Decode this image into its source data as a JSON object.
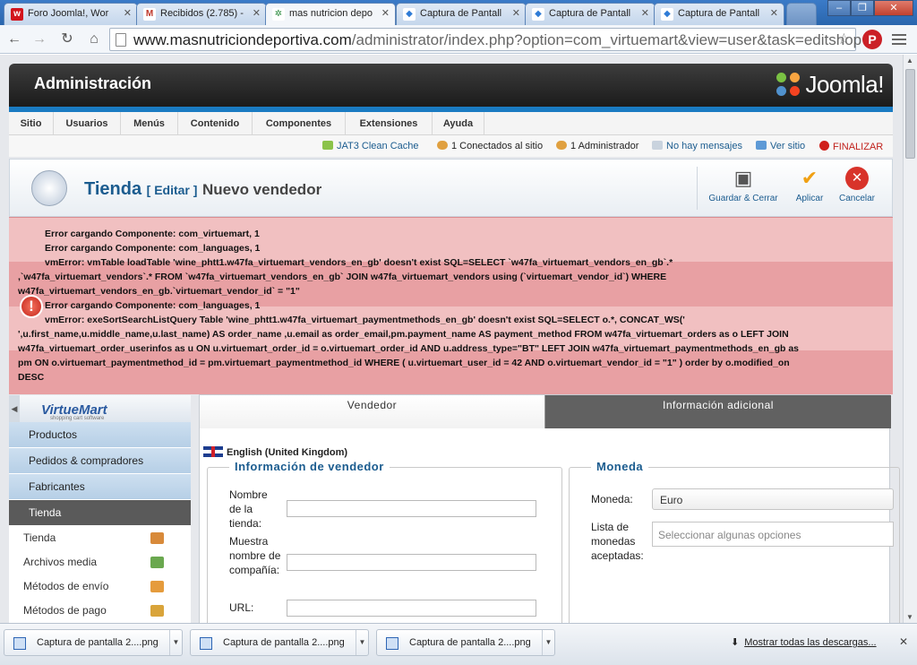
{
  "browser": {
    "tabs": [
      {
        "title": "Foro Joomla!, Wor",
        "icon": "w-favicon-icon",
        "color": "#d2151d",
        "glyph": "w"
      },
      {
        "title": "Recibidos (2.785) -",
        "icon": "gmail-icon",
        "color": "#c0392b",
        "glyph": "M"
      },
      {
        "title": "mas nutricion depo",
        "icon": "joomla-favicon-icon",
        "color": "#2a8a3e",
        "glyph": "✲"
      },
      {
        "title": "Captura de Pantall",
        "icon": "dropbox-icon",
        "color": "#2e7bd6",
        "glyph": "◆"
      },
      {
        "title": "Captura de Pantall",
        "icon": "dropbox-icon",
        "color": "#2e7bd6",
        "glyph": "◆"
      },
      {
        "title": "Captura de Pantall",
        "icon": "dropbox-icon",
        "color": "#2e7bd6",
        "glyph": "◆"
      }
    ],
    "url_host": "www.masnutriciondeportiva.com",
    "url_path": "/administrator/index.php?option=com_virtuemart&view=user&task=editshop"
  },
  "admin": {
    "title": "Administración",
    "logo_text": "Joomla!",
    "menu": [
      "Sitio",
      "Usuarios",
      "Menús",
      "Contenido",
      "Componentes",
      "Extensiones",
      "Ayuda"
    ],
    "status": {
      "cache": "JAT3 Clean Cache",
      "online": "1 Conectados al sitio",
      "admins": "1 Administrador",
      "messages": "No hay mensajes",
      "view_site": "Ver sitio",
      "logout": "FINALIZAR"
    }
  },
  "page": {
    "title": "Tienda",
    "edit_label": "[ Editar ]",
    "subtitle": "Nuevo vendedor",
    "buttons": {
      "save_close": "Guardar & Cerrar",
      "apply": "Aplicar",
      "cancel": "Cancelar"
    }
  },
  "errors": [
    "Error cargando Componente: com_virtuemart, 1",
    "Error cargando Componente: com_languages, 1",
    "vmError: vmTable loadTable 'wine_phtt1.w47fa_virtuemart_vendors_en_gb' doesn't exist SQL=SELECT `w47fa_virtuemart_vendors_en_gb`.*",
    ",`w47fa_virtuemart_vendors`.* FROM `w47fa_virtuemart_vendors_en_gb` JOIN w47fa_virtuemart_vendors using (`virtuemart_vendor_id`) WHERE",
    "w47fa_virtuemart_vendors_en_gb.`virtuemart_vendor_id` = \"1\"",
    "Error cargando Componente: com_languages, 1",
    "vmError: exeSortSearchListQuery Table 'wine_phtt1.w47fa_virtuemart_paymentmethods_en_gb' doesn't exist SQL=SELECT o.*, CONCAT_WS('",
    "',u.first_name,u.middle_name,u.last_name) AS order_name ,u.email as order_email,pm.payment_name AS payment_method FROM w47fa_virtuemart_orders as o LEFT JOIN",
    "w47fa_virtuemart_order_userinfos as u ON u.virtuemart_order_id = o.virtuemart_order_id AND u.address_type=\"BT\" LEFT JOIN w47fa_virtuemart_paymentmethods_en_gb as",
    "pm ON o.virtuemart_paymentmethod_id = pm.virtuemart_paymentmethod_id WHERE ( u.virtuemart_user_id = 42 AND o.virtuemart_vendor_id = \"1\" ) order by o.modified_on",
    "DESC"
  ],
  "sidebar": {
    "logo_text": "VirtueMart",
    "logo_sub": "shopping cart software",
    "sections": [
      "Productos",
      "Pedidos & compradores",
      "Fabricantes",
      "Tienda"
    ],
    "items": [
      {
        "label": "Tienda",
        "icon": "shop-icon",
        "color": "#d88a3a"
      },
      {
        "label": "Archivos media",
        "icon": "media-icon",
        "color": "#6aa84f"
      },
      {
        "label": "Métodos de envío",
        "icon": "truck-icon",
        "color": "#e59b3c"
      },
      {
        "label": "Métodos de pago",
        "icon": "payment-icon",
        "color": "#d9a43a"
      }
    ]
  },
  "form": {
    "tabs": [
      "Vendedor",
      "Información adicional"
    ],
    "language": "English (United Kingdom)",
    "vendor_legend": "Información de vendedor",
    "store_name_label": "Nombre de la tienda:",
    "company_label": "Muestra nombre de compañía:",
    "url_label": "URL:",
    "currency_legend": "Moneda",
    "currency_label": "Moneda:",
    "currency_value": "Euro",
    "accepted_label": "Lista de monedas aceptadas:",
    "accepted_placeholder": "Seleccionar algunas opciones"
  },
  "downloads": {
    "items": [
      "Captura de pantalla 2....png",
      "Captura de pantalla 2....png",
      "Captura de pantalla 2....png"
    ],
    "show_all": "Mostrar todas las descargas..."
  }
}
